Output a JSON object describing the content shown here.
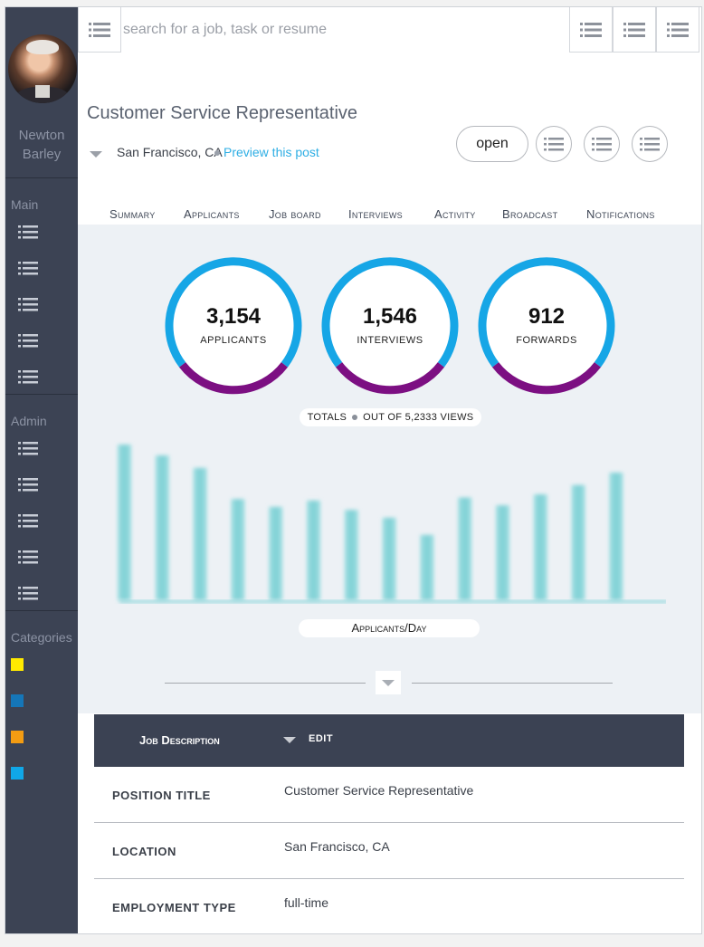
{
  "user": {
    "first_name": "Newton",
    "last_name": "Barley"
  },
  "sidebar": {
    "sections": [
      {
        "heading": "Main",
        "item_count": 5
      },
      {
        "heading": "Admin",
        "item_count": 5
      },
      {
        "heading": "Categories"
      }
    ],
    "categories": [
      {
        "color": "#ffea00"
      },
      {
        "color": "#1576b8"
      },
      {
        "color": "#f39c12"
      },
      {
        "color": "#10a7e8"
      }
    ]
  },
  "topbar": {
    "search_placeholder": "search for a job, task or resume"
  },
  "job": {
    "title": "Customer Service Representative",
    "location": "San Francisco, CA",
    "preview_link": "Preview this post",
    "status_button": "open"
  },
  "tabs": [
    "Summary",
    "Applicants",
    "Job board",
    "Interviews",
    "Activity",
    "Broadcast",
    "Notifications"
  ],
  "stats": [
    {
      "value": "3,154",
      "label": "Applicants"
    },
    {
      "value": "1,546",
      "label": "Interviews"
    },
    {
      "value": "912",
      "label": "Forwards"
    }
  ],
  "totals": {
    "label": "TOTALS",
    "views": "OUT OF 5,2333 VIEWS"
  },
  "chart_data": {
    "type": "bar",
    "values": [
      100,
      93,
      85,
      65,
      60,
      64,
      58,
      53,
      42,
      66,
      61,
      68,
      74,
      82
    ],
    "xlabel": "Applicants/Day"
  },
  "job_description": {
    "header": "Job Description",
    "edit_label": "EDIT",
    "rows": [
      {
        "key": "POSITION TITLE",
        "value": "Customer Service Representative"
      },
      {
        "key": "LOCATION",
        "value": "San Francisco, CA"
      },
      {
        "key": "EMPLOYMENT TYPE",
        "value": "full-time"
      }
    ]
  },
  "colors": {
    "sidebar_bg": "#3c4354",
    "ring_blue": "#16a6e6",
    "ring_purple": "#7c0f82",
    "bar_teal": "#8ed7db",
    "link_blue": "#2eaee4"
  }
}
